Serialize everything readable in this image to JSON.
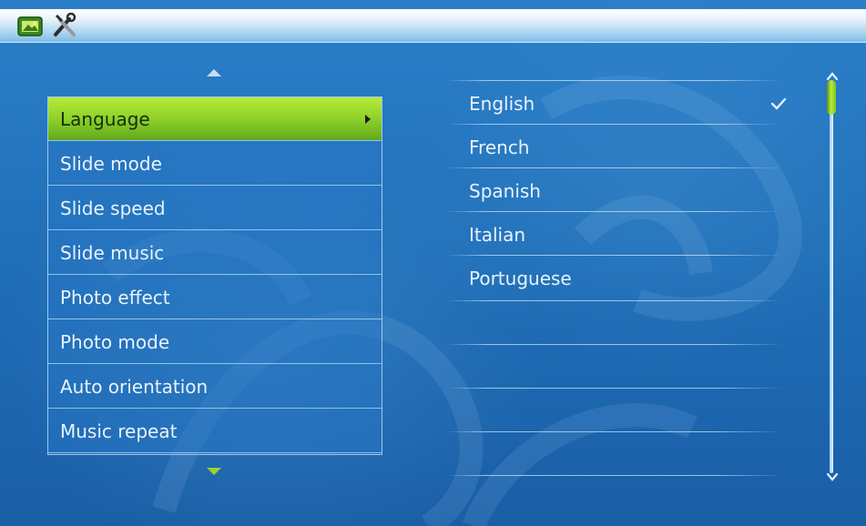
{
  "toolbar": {
    "icons": [
      "photo-icon",
      "tools-icon"
    ]
  },
  "menu": {
    "items": [
      {
        "label": "Language",
        "selected": true
      },
      {
        "label": "Slide mode"
      },
      {
        "label": "Slide speed"
      },
      {
        "label": "Slide music"
      },
      {
        "label": "Photo effect"
      },
      {
        "label": "Photo mode"
      },
      {
        "label": "Auto orientation"
      },
      {
        "label": "Music repeat"
      }
    ]
  },
  "language_options": {
    "items": [
      {
        "label": "English",
        "checked": true
      },
      {
        "label": "French"
      },
      {
        "label": "Spanish"
      },
      {
        "label": "Italian"
      },
      {
        "label": "Portuguese"
      }
    ]
  },
  "colors": {
    "background": "#1f6fb8",
    "selection": "#8ed12a",
    "text": "#e8f3fd"
  }
}
